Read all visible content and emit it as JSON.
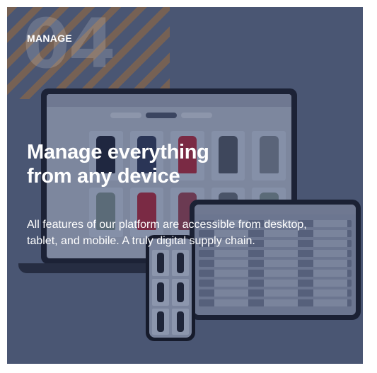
{
  "card": {
    "number": "04",
    "eyebrow": "MANAGE",
    "headline": "Manage everything from any device",
    "body": "All features of our platform are accessible from desktop, tablet, and mobile. A truly digital supply chain."
  },
  "colors": {
    "background": "#4a5673",
    "stripe": "#9a6a3a",
    "text": "#ffffff"
  }
}
